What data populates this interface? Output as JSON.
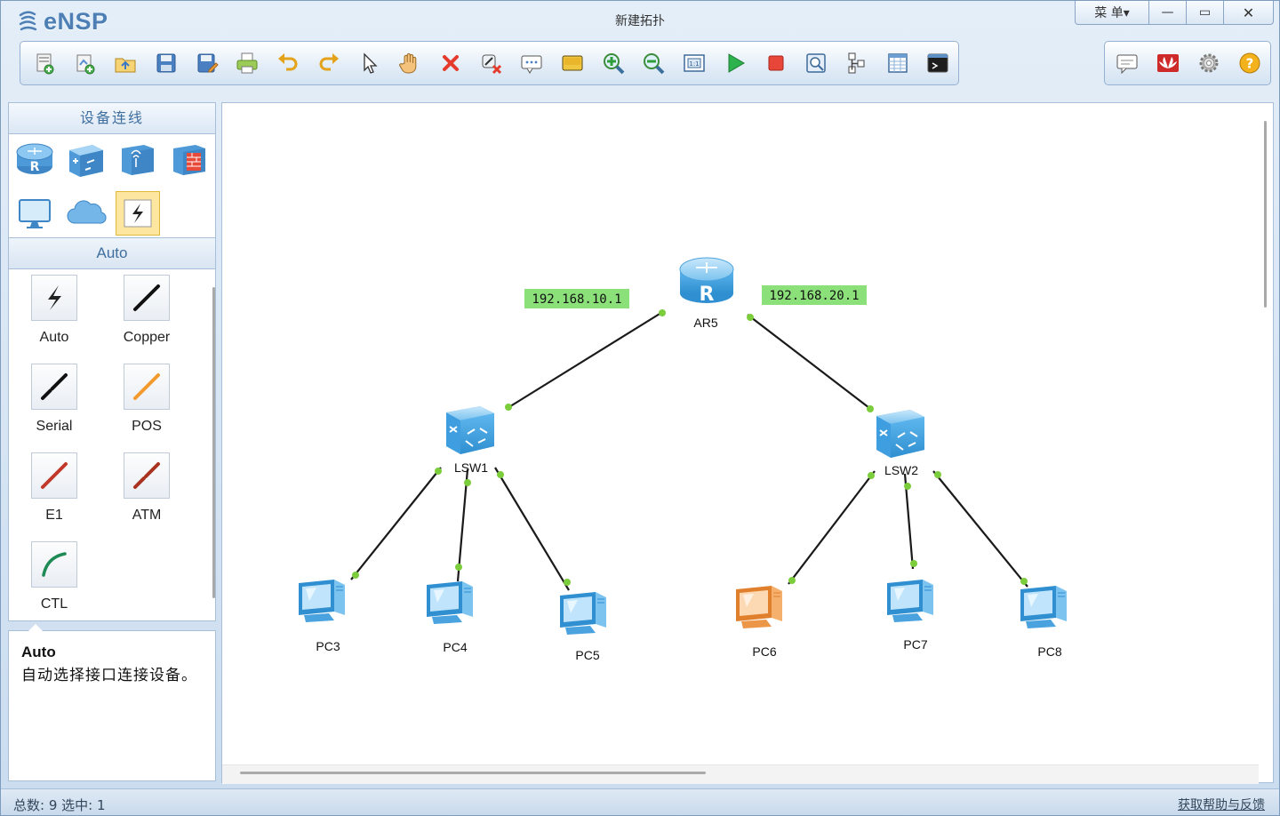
{
  "app": {
    "name": "eNSP",
    "window_title": "新建拓扑"
  },
  "window_controls": {
    "menu_label": "菜 单▾",
    "minimize": "—",
    "maximize": "▭",
    "close": "✕"
  },
  "toolbar": {
    "left": [
      {
        "icon": "new-topology-icon"
      },
      {
        "icon": "new-lab-icon"
      },
      {
        "icon": "open-icon"
      },
      {
        "icon": "save-icon"
      },
      {
        "icon": "save-as-icon"
      },
      {
        "icon": "print-icon"
      },
      {
        "icon": "undo-icon"
      },
      {
        "icon": "redo-icon"
      },
      {
        "icon": "select-pointer-icon"
      },
      {
        "icon": "hand-pan-icon"
      },
      {
        "icon": "delete-icon"
      },
      {
        "icon": "delete-link-icon"
      },
      {
        "icon": "text-note-icon"
      },
      {
        "icon": "palette-icon"
      },
      {
        "icon": "zoom-in-icon"
      },
      {
        "icon": "zoom-out-icon"
      },
      {
        "icon": "fit-view-icon"
      },
      {
        "icon": "start-icon"
      },
      {
        "icon": "stop-icon"
      },
      {
        "icon": "capture-icon"
      },
      {
        "icon": "topology-icon"
      },
      {
        "icon": "grid-table-icon"
      },
      {
        "icon": "terminal-icon"
      }
    ],
    "right": [
      {
        "icon": "chat-icon"
      },
      {
        "icon": "huawei-icon"
      },
      {
        "icon": "settings-gear-icon"
      },
      {
        "icon": "help-icon"
      }
    ]
  },
  "left_panel": {
    "header": "设备连线",
    "categories": [
      {
        "icon": "router-category-icon"
      },
      {
        "icon": "switch-category-icon"
      },
      {
        "icon": "wireless-category-icon"
      },
      {
        "icon": "firewall-category-icon"
      },
      {
        "icon": "terminal-pc-category-icon"
      },
      {
        "icon": "cloud-category-icon"
      },
      {
        "icon": "connection-category-icon",
        "selected": true
      }
    ],
    "sub_header": "Auto",
    "cables": [
      {
        "label": "Auto",
        "icon": "auto-cable-icon",
        "color": "#222222"
      },
      {
        "label": "Copper",
        "icon": "copper-cable-icon",
        "color": "#111111"
      },
      {
        "label": "Serial",
        "icon": "serial-cable-icon",
        "color": "#111111"
      },
      {
        "label": "POS",
        "icon": "pos-cable-icon",
        "color": "#f29a2e"
      },
      {
        "label": "E1",
        "icon": "e1-cable-icon",
        "color": "#c0392b"
      },
      {
        "label": "ATM",
        "icon": "atm-cable-icon",
        "color": "#a93220"
      },
      {
        "label": "CTL",
        "icon": "ctl-cable-icon",
        "color": "#1e8a55"
      }
    ],
    "description": {
      "title": "Auto",
      "text": "自动选择接口连接设备。"
    }
  },
  "topology": {
    "ip_labels": [
      "192.168.10.1",
      "192.168.20.1"
    ],
    "nodes": [
      {
        "id": "AR5",
        "label": "AR5",
        "type": "router"
      },
      {
        "id": "LSW1",
        "label": "LSW1",
        "type": "switch"
      },
      {
        "id": "LSW2",
        "label": "LSW2",
        "type": "switch"
      },
      {
        "id": "PC3",
        "label": "PC3",
        "type": "pc"
      },
      {
        "id": "PC4",
        "label": "PC4",
        "type": "pc"
      },
      {
        "id": "PC5",
        "label": "PC5",
        "type": "pc"
      },
      {
        "id": "PC6",
        "label": "PC6",
        "type": "pc",
        "state": "selected"
      },
      {
        "id": "PC7",
        "label": "PC7",
        "type": "pc"
      },
      {
        "id": "PC8",
        "label": "PC8",
        "type": "pc"
      }
    ],
    "links": [
      [
        "AR5",
        "LSW1"
      ],
      [
        "AR5",
        "LSW2"
      ],
      [
        "LSW1",
        "PC3"
      ],
      [
        "LSW1",
        "PC4"
      ],
      [
        "LSW1",
        "PC5"
      ],
      [
        "LSW2",
        "PC6"
      ],
      [
        "LSW2",
        "PC7"
      ],
      [
        "LSW2",
        "PC8"
      ]
    ],
    "colors": {
      "port_up": "#7ccd3c",
      "ip_label_bg": "#8be07a",
      "pc": "#5ab4ee",
      "pc_selected": "#f0a860",
      "device": "#5bb6ec"
    }
  },
  "status": {
    "text": "总数: 9 选中: 1",
    "link": "获取帮助与反馈"
  }
}
